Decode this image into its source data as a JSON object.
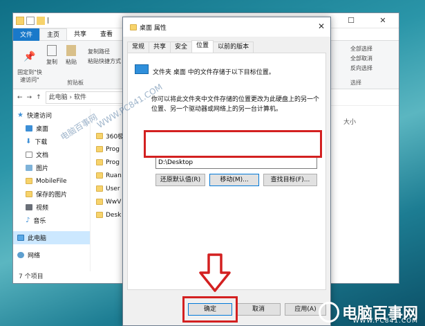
{
  "explorer": {
    "qa_hint": "|",
    "ribbon_tabs": [
      "文件",
      "主页",
      "共享",
      "查看"
    ],
    "ribbon_items": {
      "pin": "固定到\"快\n速访问\"",
      "copy": "复制",
      "paste": "粘贴",
      "copy_path": "复制路径",
      "paste_shortcut": "粘贴快捷方式",
      "select_all": "全部选择",
      "select_none": "全部取消",
      "invert_select": "反向选择",
      "clipboard_label": "剪贴板",
      "select_label": "选择"
    },
    "address": {
      "path_root": "此电脑",
      "path_next": "软件",
      "size_col": "大小"
    },
    "nav": [
      {
        "label": "快速访问",
        "icon": "star-icon"
      },
      {
        "label": "桌面",
        "icon": "desktop-icon",
        "pinned": true
      },
      {
        "label": "下载",
        "icon": "download-icon",
        "pinned": true
      },
      {
        "label": "文档",
        "icon": "document-icon",
        "pinned": true
      },
      {
        "label": "图片",
        "icon": "picture-icon",
        "pinned": true
      },
      {
        "label": "MobileFile",
        "icon": "folder-icon"
      },
      {
        "label": "保存的图片",
        "icon": "folder-icon"
      },
      {
        "label": "视频",
        "icon": "video-icon"
      },
      {
        "label": "音乐",
        "icon": "music-icon"
      },
      {
        "label": "此电脑",
        "icon": "pc-icon"
      },
      {
        "label": "网络",
        "icon": "network-icon"
      }
    ],
    "files": [
      "360极",
      "Prog",
      "Prog",
      "Ruan",
      "User",
      "WwV",
      "Desk"
    ],
    "status": "7 个项目"
  },
  "dialog": {
    "title": "桌面 属性",
    "tabs": [
      "常规",
      "共享",
      "安全",
      "位置",
      "以前的版本"
    ],
    "active_tab": "位置",
    "line1": "文件夹 桌面 中的文件存储于以下目标位置。",
    "desc": "你可以将此文件夹中文件存储的位置更改为此硬盘上的另一个位置、另一个驱动器或网络上的另一台计算机。",
    "path_value": "D:\\Desktop",
    "btn_restore": "还原默认值(R)",
    "btn_move": "移动(M)...",
    "btn_find": "查找目标(F)...",
    "btn_ok": "确定",
    "btn_cancel": "取消",
    "btn_apply": "应用(A)"
  },
  "watermark": {
    "site": "WWW.PC841.COM",
    "brand": "电脑百事网",
    "brand_url": "WWW.PC841.COM"
  }
}
